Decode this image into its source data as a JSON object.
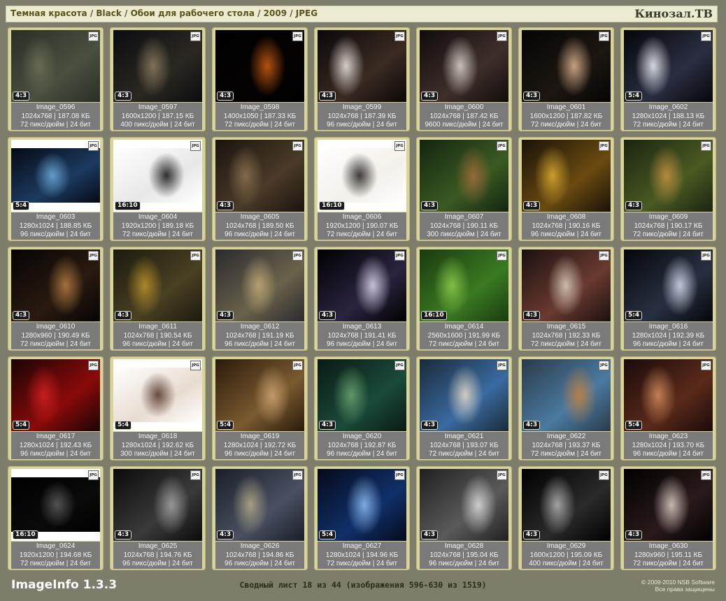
{
  "header": {
    "breadcrumb": "Темная красота / Black / Обои для рабочего стола / 2009 / JPEG",
    "site": "Кинозал.ТВ"
  },
  "badge_label": "JPG",
  "colors": {
    "background": "#7e7c6a",
    "card": "#d8d49a",
    "info_panel": "#7a7a7a",
    "header_bg": "#ecebd2"
  },
  "cards": [
    {
      "name": "Image_0596",
      "ratio": "4:3",
      "dims": "1024x768",
      "size": "187.08 КБ",
      "dpi": "72 пикс/дюйм",
      "bits": "24 бит",
      "palette": [
        "#2a2e26",
        "#49503f",
        "#6b6e58"
      ],
      "fit": "cover"
    },
    {
      "name": "Image_0597",
      "ratio": "4:3",
      "dims": "1600x1200",
      "size": "187.15 КБ",
      "dpi": "400 пикс/дюйм",
      "bits": "24 бит",
      "palette": [
        "#0b0c12",
        "#2a2820",
        "#8a7a60"
      ],
      "fit": "cover"
    },
    {
      "name": "Image_0598",
      "ratio": "4:3",
      "dims": "1400x1050",
      "size": "187.33 КБ",
      "dpi": "72 пикс/дюйм",
      "bits": "24 бит",
      "palette": [
        "#000000",
        "#050202",
        "#c85a10"
      ],
      "fit": "cover"
    },
    {
      "name": "Image_0599",
      "ratio": "4:3",
      "dims": "1024x768",
      "size": "187.39 КБ",
      "dpi": "96 пикс/дюйм",
      "bits": "24 бит",
      "palette": [
        "#0a0808",
        "#3a2a22",
        "#e8e2dc"
      ],
      "fit": "cover"
    },
    {
      "name": "Image_0600",
      "ratio": "4:3",
      "dims": "1024x768",
      "size": "187.42 КБ",
      "dpi": "9600 пикс/дюйм",
      "bits": "24 бит",
      "palette": [
        "#100c0c",
        "#3e2e2a",
        "#d8d0c8"
      ],
      "fit": "cover"
    },
    {
      "name": "Image_0601",
      "ratio": "4:3",
      "dims": "1600x1200",
      "size": "187.82 КБ",
      "dpi": "72 пикс/дюйм",
      "bits": "24 бит",
      "palette": [
        "#050505",
        "#1c1610",
        "#d9b08c"
      ],
      "fit": "cover"
    },
    {
      "name": "Image_0602",
      "ratio": "5:4",
      "dims": "1280x1024",
      "size": "188.13 КБ",
      "dpi": "72 пикс/дюйм",
      "bits": "24 бит",
      "palette": [
        "#05060a",
        "#2a2e40",
        "#e8ecf4"
      ],
      "fit": "cover"
    },
    {
      "name": "Image_0603",
      "ratio": "5:4",
      "dims": "1280x1024",
      "size": "188.85 КБ",
      "dpi": "96 пикс/дюйм",
      "bits": "24 бит",
      "palette": [
        "#050a14",
        "#1c3a60",
        "#6aa8d8"
      ],
      "fit": "contain"
    },
    {
      "name": "Image_0604",
      "ratio": "16:10",
      "dims": "1920x1200",
      "size": "189.18 КБ",
      "dpi": "72 пикс/дюйм",
      "bits": "24 бит",
      "palette": [
        "#ffffff",
        "#e8e8e8",
        "#1a1a1a"
      ],
      "fit": "contain"
    },
    {
      "name": "Image_0605",
      "ratio": "4:3",
      "dims": "1024x768",
      "size": "189.50 КБ",
      "dpi": "96 пикс/дюйм",
      "bits": "24 бит",
      "palette": [
        "#1a140e",
        "#4a3a28",
        "#8a7050"
      ],
      "fit": "cover"
    },
    {
      "name": "Image_0606",
      "ratio": "16:10",
      "dims": "1920x1200",
      "size": "190.07 КБ",
      "dpi": "72 пикс/дюйм",
      "bits": "24 бит",
      "palette": [
        "#ffffff",
        "#f4f0ea",
        "#2a2422"
      ],
      "fit": "contain"
    },
    {
      "name": "Image_0607",
      "ratio": "4:3",
      "dims": "1024x768",
      "size": "190.11 КБ",
      "dpi": "300 пикс/дюйм",
      "bits": "24 бит",
      "palette": [
        "#142410",
        "#3a5a22",
        "#a06a3a"
      ],
      "fit": "cover"
    },
    {
      "name": "Image_0608",
      "ratio": "4:3",
      "dims": "1024x768",
      "size": "190.16 КБ",
      "dpi": "96 пикс/дюйм",
      "bits": "24 бит",
      "palette": [
        "#1a1208",
        "#6a4a10",
        "#d8a830"
      ],
      "fit": "cover"
    },
    {
      "name": "Image_0609",
      "ratio": "4:3",
      "dims": "1024x768",
      "size": "190.17 КБ",
      "dpi": "72 пикс/дюйм",
      "bits": "24 бит",
      "palette": [
        "#1a2410",
        "#4a5a22",
        "#c09040"
      ],
      "fit": "cover"
    },
    {
      "name": "Image_0610",
      "ratio": "4:3",
      "dims": "1280x960",
      "size": "190.49 КБ",
      "dpi": "72 пикс/дюйм",
      "bits": "24 бит",
      "palette": [
        "#050404",
        "#2a1a10",
        "#b07a40"
      ],
      "fit": "cover"
    },
    {
      "name": "Image_0611",
      "ratio": "4:3",
      "dims": "1024x768",
      "size": "190.54 КБ",
      "dpi": "96 пикс/дюйм",
      "bits": "24 бит",
      "palette": [
        "#1a1a0e",
        "#4a4022",
        "#b8902c"
      ],
      "fit": "cover"
    },
    {
      "name": "Image_0612",
      "ratio": "4:3",
      "dims": "1024x768",
      "size": "191.19 КБ",
      "dpi": "96 пикс/дюйм",
      "bits": "24 бит",
      "palette": [
        "#2a2a30",
        "#6a624a",
        "#c0a878"
      ],
      "fit": "cover"
    },
    {
      "name": "Image_0613",
      "ratio": "4:3",
      "dims": "1024x768",
      "size": "191.41 КБ",
      "dpi": "96 пикс/дюйм",
      "bits": "24 бит",
      "palette": [
        "#000000",
        "#2a2440",
        "#d8d0e8"
      ],
      "fit": "cover"
    },
    {
      "name": "Image_0614",
      "ratio": "16:10",
      "dims": "2560x1600",
      "size": "191.99 КБ",
      "dpi": "72 пикс/дюйм",
      "bits": "24 бит",
      "palette": [
        "#1a3a10",
        "#3a7a22",
        "#8ac84a"
      ],
      "fit": "cover"
    },
    {
      "name": "Image_0615",
      "ratio": "4:3",
      "dims": "1024x768",
      "size": "192.33 КБ",
      "dpi": "72 пикс/дюйм",
      "bits": "24 бит",
      "palette": [
        "#1a1010",
        "#6a3a30",
        "#d8c8b8"
      ],
      "fit": "cover"
    },
    {
      "name": "Image_0616",
      "ratio": "5:4",
      "dims": "1280x1024",
      "size": "192.39 КБ",
      "dpi": "96 пикс/дюйм",
      "bits": "24 бит",
      "palette": [
        "#05060a",
        "#283040",
        "#d0d8e8"
      ],
      "fit": "cover"
    },
    {
      "name": "Image_0617",
      "ratio": "5:4",
      "dims": "1280x1024",
      "size": "192.43 КБ",
      "dpi": "96 пикс/дюйм",
      "bits": "24 бит",
      "palette": [
        "#1a0404",
        "#8a0a0a",
        "#d02020"
      ],
      "fit": "cover"
    },
    {
      "name": "Image_0618",
      "ratio": "5:4",
      "dims": "1280x1024",
      "size": "192.62 КБ",
      "dpi": "300 пикс/дюйм",
      "bits": "24 бит",
      "palette": [
        "#ffffff",
        "#e8dcd0",
        "#5a3a30"
      ],
      "fit": "contain"
    },
    {
      "name": "Image_0619",
      "ratio": "5:4",
      "dims": "1280x1024",
      "size": "192.72 КБ",
      "dpi": "96 пикс/дюйм",
      "bits": "24 бит",
      "palette": [
        "#2a1a0a",
        "#7a5a30",
        "#c8a070"
      ],
      "fit": "cover"
    },
    {
      "name": "Image_0620",
      "ratio": "4:3",
      "dims": "1024x768",
      "size": "192.87 КБ",
      "dpi": "96 пикс/дюйм",
      "bits": "24 бит",
      "palette": [
        "#0a1a14",
        "#1a4a3a",
        "#6aa070"
      ],
      "fit": "cover"
    },
    {
      "name": "Image_0621",
      "ratio": "4:3",
      "dims": "1024x768",
      "size": "193.07 КБ",
      "dpi": "72 пикс/дюйм",
      "bits": "24 бит",
      "palette": [
        "#1a2a3a",
        "#3a6aa0",
        "#e0d8c8"
      ],
      "fit": "cover"
    },
    {
      "name": "Image_0622",
      "ratio": "4:3",
      "dims": "1024x768",
      "size": "193.37 КБ",
      "dpi": "72 пикс/дюйм",
      "bits": "24 бит",
      "palette": [
        "#2a3a4a",
        "#4a7aa0",
        "#c08040"
      ],
      "fit": "cover"
    },
    {
      "name": "Image_0623",
      "ratio": "5:4",
      "dims": "1280x1024",
      "size": "193.70 КБ",
      "dpi": "96 пикс/дюйм",
      "bits": "24 бит",
      "palette": [
        "#1a0a0a",
        "#5a2a1a",
        "#d08a5a"
      ],
      "fit": "cover"
    },
    {
      "name": "Image_0624",
      "ratio": "16:10",
      "dims": "1920x1200",
      "size": "194.68 КБ",
      "dpi": "72 пикс/дюйм",
      "bits": "24 бит",
      "palette": [
        "#000000",
        "#0a0a0a",
        "#5a5a5a"
      ],
      "fit": "contain"
    },
    {
      "name": "Image_0625",
      "ratio": "4:3",
      "dims": "1024x768",
      "size": "194.76 КБ",
      "dpi": "96 пикс/дюйм",
      "bits": "24 бит",
      "palette": [
        "#0a0a0a",
        "#3a3a3a",
        "#a0a0a0"
      ],
      "fit": "cover"
    },
    {
      "name": "Image_0626",
      "ratio": "4:3",
      "dims": "1024x768",
      "size": "194.86 КБ",
      "dpi": "96 пикс/дюйм",
      "bits": "24 бит",
      "palette": [
        "#1a1e2a",
        "#4a5060",
        "#b0a888"
      ],
      "fit": "cover"
    },
    {
      "name": "Image_0627",
      "ratio": "5:4",
      "dims": "1280x1024",
      "size": "194.96 КБ",
      "dpi": "72 пикс/дюйм",
      "bits": "24 бит",
      "palette": [
        "#050a1a",
        "#10306a",
        "#8ab8f0"
      ],
      "fit": "cover"
    },
    {
      "name": "Image_0628",
      "ratio": "4:3",
      "dims": "1024x768",
      "size": "195.04 КБ",
      "dpi": "96 пикс/дюйм",
      "bits": "24 бит",
      "palette": [
        "#202020",
        "#5a5a5a",
        "#d8d8d8"
      ],
      "fit": "cover"
    },
    {
      "name": "Image_0629",
      "ratio": "4:3",
      "dims": "1600x1200",
      "size": "195.09 КБ",
      "dpi": "400 пикс/дюйм",
      "bits": "24 бит",
      "palette": [
        "#000000",
        "#2a2a2a",
        "#b0b0b0"
      ],
      "fit": "cover"
    },
    {
      "name": "Image_0630",
      "ratio": "4:3",
      "dims": "1280x960",
      "size": "195.11 КБ",
      "dpi": "72 пикс/дюйм",
      "bits": "24 бит",
      "palette": [
        "#000000",
        "#2a1a1a",
        "#d8c8c0"
      ],
      "fit": "cover"
    }
  ],
  "footer": {
    "app": "ImageInfo 1.3.3",
    "summary": "Сводный лист 18 из 44 (изображения 596-630 из 1519)",
    "copyright": "© 2009-2010 NSB Software",
    "rights": "Все права защищены"
  }
}
